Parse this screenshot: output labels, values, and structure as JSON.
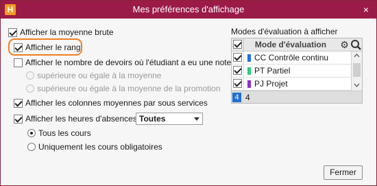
{
  "window": {
    "logo_letter": "H",
    "title": "Mes préférences d'affichage",
    "accent_color": "#9b1b48",
    "close_icon": "×"
  },
  "options": {
    "moyenne_brute": {
      "label": "Afficher la moyenne brute",
      "checked": true
    },
    "rang": {
      "label": "Afficher le rang",
      "checked": true,
      "highlight_color": "#f07f22"
    },
    "nb_devoirs": {
      "label": "Afficher le nombre de devoirs où l'étudiant a eu une note",
      "checked": false
    },
    "sup_moyenne": {
      "label": "supérieure ou égale à la moyenne"
    },
    "sup_moyenne_promo": {
      "label": "supérieure ou égale à la moyenne de la promotion"
    },
    "colonnes_sous_services": {
      "label": "Afficher les colonnes moyennes par sous services",
      "checked": true
    },
    "heures_absences": {
      "label": "Afficher les heures d'absences",
      "checked": true,
      "select_value": "Toutes"
    },
    "tous_cours": {
      "label": "Tous les cours",
      "selected": true
    },
    "cours_obligatoires": {
      "label": "Uniquement les cours obligatoires",
      "selected": false
    }
  },
  "modes": {
    "section_label": "Modes d'évaluation à afficher",
    "header": "Mode d'évaluation",
    "gear_icon": "gear-icon",
    "search_icon": "magnifier-icon",
    "rows": [
      {
        "label": "CC Contrôle continu",
        "color": "#1a73e8"
      },
      {
        "label": "PT Partiel",
        "color": "#26d07c"
      },
      {
        "label": "PJ Projet",
        "color": "#8b2fc9"
      }
    ],
    "count_badge": "4",
    "count_text": "4"
  },
  "footer": {
    "close_button": "Fermer"
  }
}
